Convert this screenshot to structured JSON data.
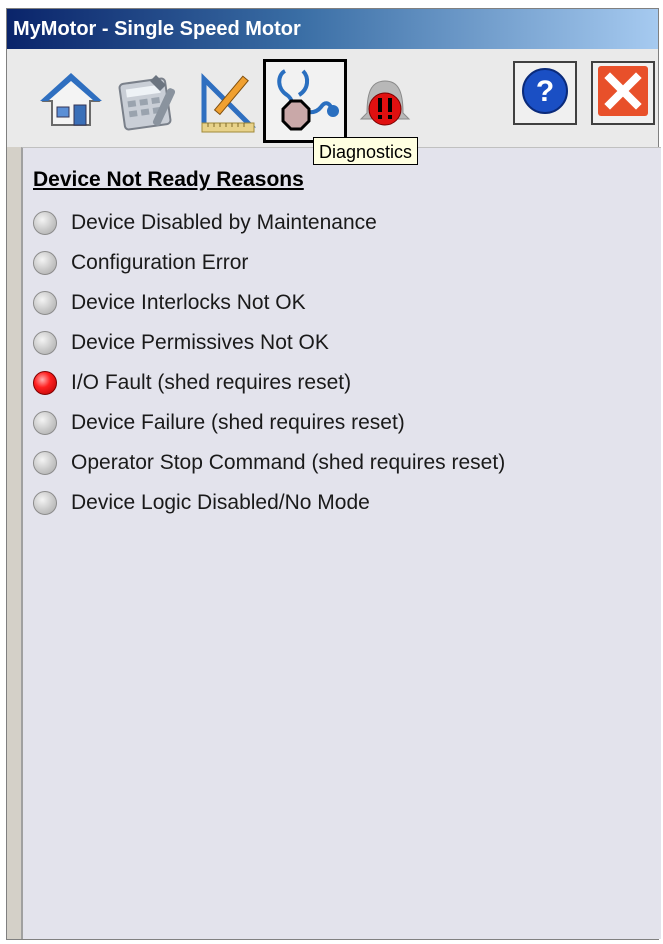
{
  "window": {
    "title": "MyMotor - Single Speed Motor"
  },
  "toolbar": {
    "tabs": [
      {
        "icon": "home-icon"
      },
      {
        "icon": "maintenance-calculator-icon"
      },
      {
        "icon": "engineering-tools-icon"
      },
      {
        "icon": "stethoscope-diagnostics-icon",
        "selected": true
      },
      {
        "icon": "alarm-bell-icon"
      }
    ],
    "help_icon": "help-icon",
    "close_icon": "close-icon",
    "tooltip": "Diagnostics"
  },
  "panel": {
    "heading": "Device Not Ready Reasons",
    "items": [
      {
        "label": "Device Disabled by Maintenance",
        "active": false
      },
      {
        "label": "Configuration Error",
        "active": false
      },
      {
        "label": "Device Interlocks Not OK",
        "active": false
      },
      {
        "label": "Device Permissives Not OK",
        "active": false
      },
      {
        "label": "I/O Fault (shed requires reset)",
        "active": true
      },
      {
        "label": "Device Failure (shed requires reset)",
        "active": false
      },
      {
        "label": "Operator Stop Command (shed requires reset)",
        "active": false
      },
      {
        "label": "Device Logic Disabled/No Mode",
        "active": false
      }
    ]
  },
  "colors": {
    "titlebar_start": "#0a246a",
    "titlebar_end": "#a6caf0",
    "active_indicator": "#ff2020",
    "inactive_indicator": "#c8c8c8",
    "help_blue": "#1a4fc4",
    "close_orange": "#e8502a"
  }
}
